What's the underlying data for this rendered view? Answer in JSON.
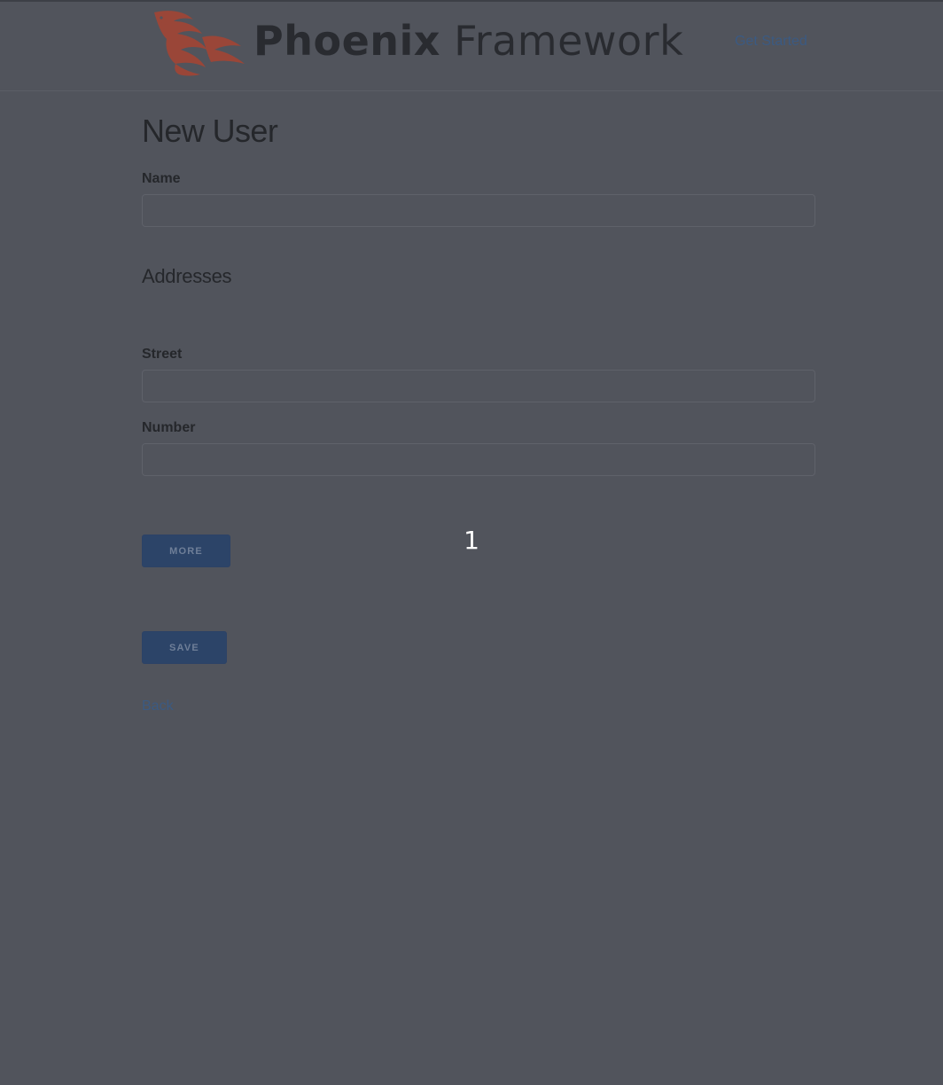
{
  "header": {
    "logo_word_bold": "Phoenix",
    "logo_word_light": "Framework",
    "nav_link": "Get Started"
  },
  "form": {
    "title": "New User",
    "name": {
      "label": "Name",
      "value": ""
    },
    "addresses_heading": "Addresses",
    "street": {
      "label": "Street",
      "value": ""
    },
    "number": {
      "label": "Number",
      "value": ""
    },
    "more_button": "MORE",
    "save_button": "SAVE",
    "back_link": "Back"
  },
  "overlay": {
    "marker_label": "1"
  },
  "colors": {
    "background": "#51545c",
    "brand_flame": "#b14b3d",
    "button": "#2c4468",
    "link": "#3b5a82"
  },
  "icons": {
    "logo": "phoenix-bird-icon"
  }
}
